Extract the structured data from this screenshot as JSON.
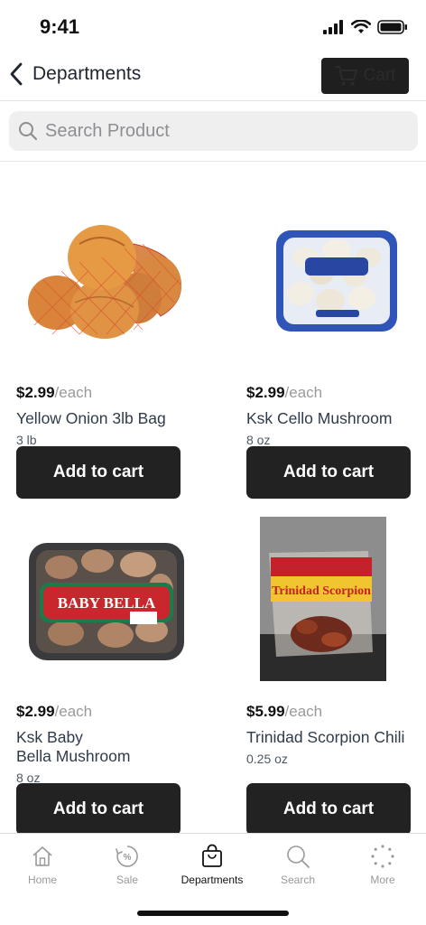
{
  "status_bar": {
    "time": "9:41",
    "icons": [
      "signal-icon",
      "wifi-icon",
      "battery-icon"
    ]
  },
  "nav": {
    "back_label": "Departments",
    "cart_label": "Cart",
    "icons": [
      "chevron-left-icon",
      "cart-icon"
    ]
  },
  "search": {
    "placeholder": "Search Product",
    "value": ""
  },
  "products": [
    {
      "price": "$2.99",
      "unit": "/each",
      "name": "Yellow Onion 3lb Bag",
      "size": "3 lb",
      "button": "Add to cart",
      "image": "yellow-onion-bag-image"
    },
    {
      "price": "$2.99",
      "unit": "/each",
      "name": "Ksk Cello Mushroom",
      "size": "8 oz",
      "button": "Add to cart",
      "image": "cello-mushroom-package-image"
    },
    {
      "price": "$2.99",
      "unit": "/each",
      "name": "Ksk Baby\nBella Mushroom",
      "size": "8 oz",
      "button": "Add to cart",
      "image": "baby-bella-package-image",
      "package_text": "BABY BELLA"
    },
    {
      "price": "$5.99",
      "unit": "/each",
      "name": "Trinidad Scorpion Chili",
      "size": "0.25 oz",
      "button": "Add to cart",
      "image": "scorpion-chili-bag-image",
      "package_text": "Trinidad Scorpion"
    }
  ],
  "tabs": [
    {
      "label": "Home",
      "icon": "home-icon",
      "active": false
    },
    {
      "label": "Sale",
      "icon": "sale-icon",
      "active": false
    },
    {
      "label": "Departments",
      "icon": "shopping-bag-icon",
      "active": true
    },
    {
      "label": "Search",
      "icon": "search-icon",
      "active": false
    },
    {
      "label": "More",
      "icon": "more-icon",
      "active": false
    }
  ],
  "colors": {
    "primary_button": "#222222",
    "muted_text": "#9a9a9a",
    "search_bg": "#efeff0"
  }
}
